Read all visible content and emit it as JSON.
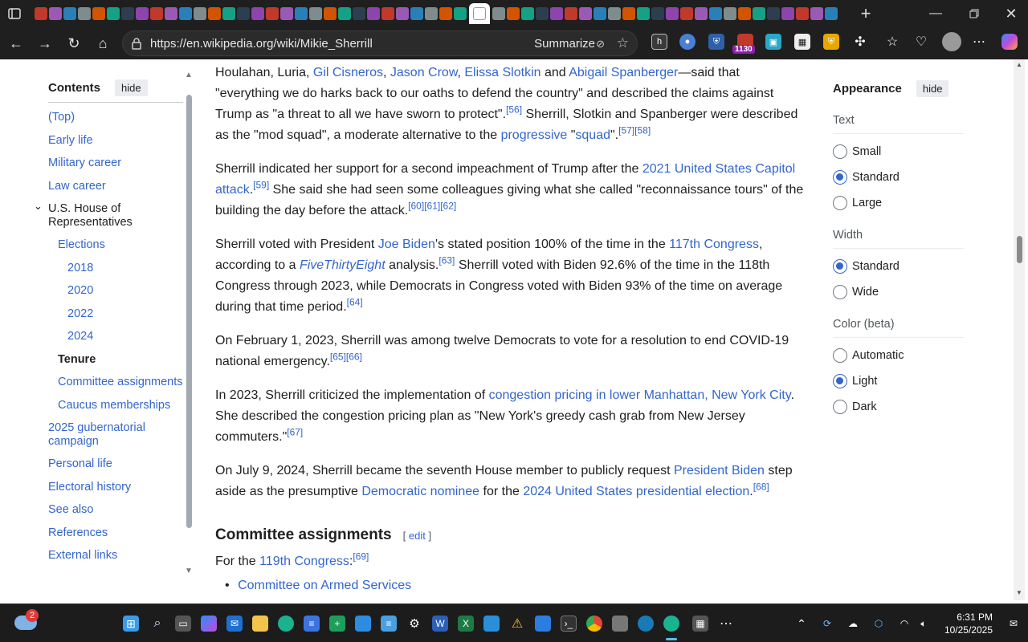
{
  "browser": {
    "url": "https://en.wikipedia.org/wiki/Mikie_Sherrill",
    "summarize_label": "Summarize",
    "badge_count": "1130"
  },
  "toc": {
    "title": "Contents",
    "hide_label": "hide",
    "items": [
      {
        "label": "(Top)"
      },
      {
        "label": "Early life"
      },
      {
        "label": "Military career"
      },
      {
        "label": "Law career"
      },
      {
        "label": "U.S. House of Representatives"
      },
      {
        "label": "Elections"
      },
      {
        "label": "2018"
      },
      {
        "label": "2020"
      },
      {
        "label": "2022"
      },
      {
        "label": "2024"
      },
      {
        "label": "Tenure"
      },
      {
        "label": "Committee assignments"
      },
      {
        "label": "Caucus memberships"
      },
      {
        "label": "2025 gubernatorial campaign"
      },
      {
        "label": "Personal life"
      },
      {
        "label": "Electoral history"
      },
      {
        "label": "See also"
      },
      {
        "label": "References"
      },
      {
        "label": "External links"
      }
    ]
  },
  "article": {
    "p1": {
      "t1": "Houlahan, Luria, ",
      "l1": "Gil Cisneros",
      "t2": ", ",
      "l2": "Jason Crow",
      "t3": ", ",
      "l3": "Elissa Slotkin",
      "t4": " and ",
      "l4": "Abigail Spanberger",
      "t5": "—said that \"everything we do harks back to our oaths to defend the country\" and described the claims against Trump as \"a threat to all we have sworn to protect\".",
      "r1": "[56]",
      "t6": " Sherrill, Slotkin and Spanberger were described as the \"mod squad\", a moderate alternative to the ",
      "l5": "progressive",
      "t7": " \"",
      "l6": "squad",
      "t8": "\".",
      "r2": "[57][58]"
    },
    "p2": {
      "t1": "Sherrill indicated her support for a second impeachment of Trump after the ",
      "l1": "2021 United States Capitol attack",
      "t2": ".",
      "r1": "[59]",
      "t3": " She said she had seen some colleagues giving what she called \"reconnaissance tours\" of the building the day before the attack.",
      "r2": "[60][61][62]"
    },
    "p3": {
      "t1": "Sherrill voted with President ",
      "l1": "Joe Biden",
      "t2": "'s stated position 100% of the time in the ",
      "l2": "117th Congress",
      "t3": ", according to a ",
      "l3": "FiveThirtyEight",
      "t4": " analysis.",
      "r1": "[63]",
      "t5": " Sherrill voted with Biden 92.6% of the time in the 118th Congress through 2023, while Democrats in Congress voted with Biden 93% of the time on average during that time period.",
      "r2": "[64]"
    },
    "p4": {
      "t1": "On February 1, 2023, Sherrill was among twelve Democrats to vote for a resolution to end COVID-19 national emergency.",
      "r1": "[65][66]"
    },
    "p5": {
      "t1": "In 2023, Sherrill criticized the implementation of ",
      "l1": "congestion pricing in lower Manhattan, New York City",
      "t2": ". She described the congestion pricing plan as \"New York's greedy cash grab from New Jersey commuters.\"",
      "r1": "[67]"
    },
    "p6": {
      "t1": "On July 9, 2024, Sherrill became the seventh House member to publicly request ",
      "l1": "President Biden",
      "t2": " step aside as the presumptive ",
      "l2": "Democratic nominee",
      "t3": " for the ",
      "l3": "2024 United States presidential election",
      "t4": ".",
      "r1": "[68]"
    },
    "section_heading": "Committee assignments",
    "edit_open": "[ ",
    "edit_label": "edit",
    "edit_close": " ]",
    "p7": {
      "t1": "For the ",
      "l1": "119th Congress",
      "t2": ":",
      "r1": "[69]"
    },
    "list_item_1": "Committee on Armed Services"
  },
  "appearance": {
    "title": "Appearance",
    "hide_label": "hide",
    "text_label": "Text",
    "text_options": [
      "Small",
      "Standard",
      "Large"
    ],
    "text_selected": "Standard",
    "width_label": "Width",
    "width_options": [
      "Standard",
      "Wide"
    ],
    "width_selected": "Standard",
    "color_label": "Color (beta)",
    "color_options": [
      "Automatic",
      "Light",
      "Dark"
    ],
    "color_selected": "Light"
  },
  "taskbar": {
    "weather_badge": "2",
    "time": "6:31 PM",
    "date": "10/25/2025"
  },
  "colors": {
    "link": "#3366cc",
    "chrome": "#1f1f1f",
    "taskbar": "#1c1c1c"
  }
}
